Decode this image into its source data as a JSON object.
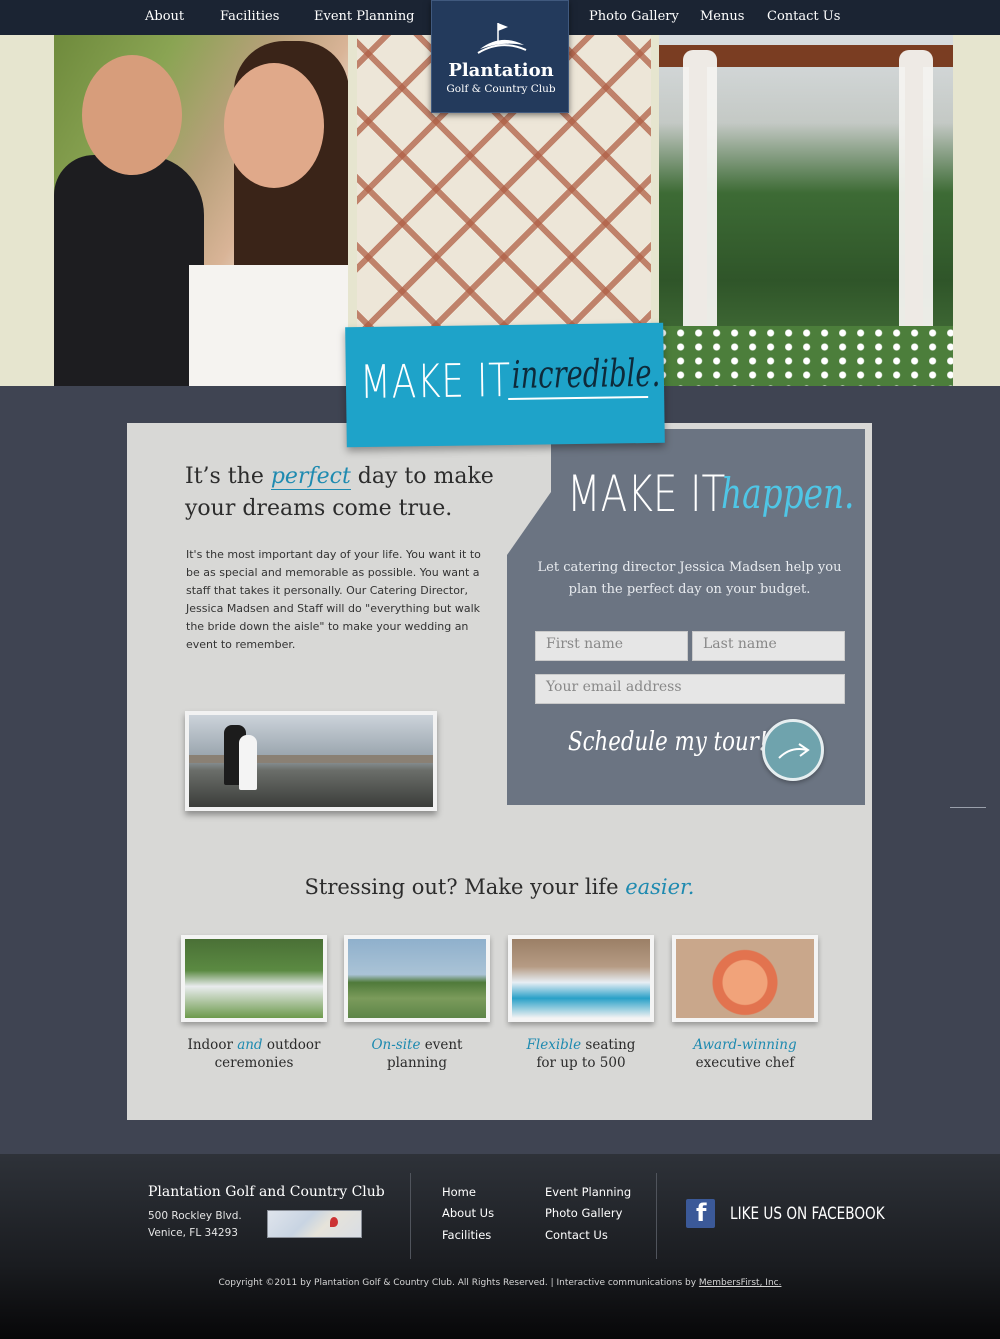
{
  "nav": {
    "left": [
      "About",
      "Facilities",
      "Event Planning"
    ],
    "right": [
      "Photo Gallery",
      "Menus",
      "Contact Us"
    ]
  },
  "logo": {
    "name": "Plantation",
    "sub": "Golf & Country Club"
  },
  "tagline": {
    "lead": "MAKE IT",
    "accent": "incredible."
  },
  "intro": {
    "headline_pre": "It’s the",
    "headline_accent": "perfect",
    "headline_post": "day to make your dreams come true.",
    "body": "It's the most important day of your life.  You want it to be as special and memorable as possible.  You want a staff that takes it personally.  Our Catering Director, Jessica Madsen and Staff will do \"everything but walk the bride down the aisle\" to make your wedding an event to remember."
  },
  "form": {
    "title_lead": "MAKE IT",
    "title_accent": "happen.",
    "text": "Let catering director Jessica Madsen help you plan the perfect day on your budget.",
    "first_name_placeholder": "First name",
    "last_name_placeholder": "Last name",
    "email_placeholder": "Your email address",
    "cta": "Schedule my tour!"
  },
  "easier": {
    "lead": "Stressing out? Make your life",
    "accent": "easier."
  },
  "features": [
    {
      "pre": "Indoor ",
      "accent": "and",
      "post": " outdoor",
      "line2": "ceremonies"
    },
    {
      "pre": "",
      "accent": "On-site",
      "post": " event",
      "line2": "planning"
    },
    {
      "pre": "",
      "accent": "Flexible",
      "post": " seating",
      "line2": "for up to 500"
    },
    {
      "pre": "",
      "accent": "Award-winning",
      "post": "",
      "line2": "executive chef"
    }
  ],
  "footer": {
    "club": "Plantation Golf and Country Club",
    "address1": "500 Rockley Blvd.",
    "address2": "Venice, FL 34293",
    "links_col1": [
      "Home",
      "About Us",
      "Facilities"
    ],
    "links_col2": [
      "Event Planning",
      "Photo Gallery",
      "Contact Us"
    ],
    "facebook": "LIKE US ON FACEBOOK",
    "copyright": "Copyright ©2011 by Plantation Golf & Country Club. All Rights Reserved. | Interactive communications by",
    "credit_link": "MembersFirst, Inc."
  },
  "colors": {
    "accent": "#1ea3c9",
    "nav_bg": "#1b2433",
    "page_bg": "#3f4452",
    "panel_bg": "#d8d8d6",
    "form_bg": "#6b7482",
    "logo_bg": "#233a5c",
    "facebook": "#3b5998"
  },
  "icons": {
    "arrow": "arrow-right-icon",
    "facebook": "facebook-icon",
    "map": "map-thumbnail",
    "logo_mark": "golf-flag-icon"
  }
}
